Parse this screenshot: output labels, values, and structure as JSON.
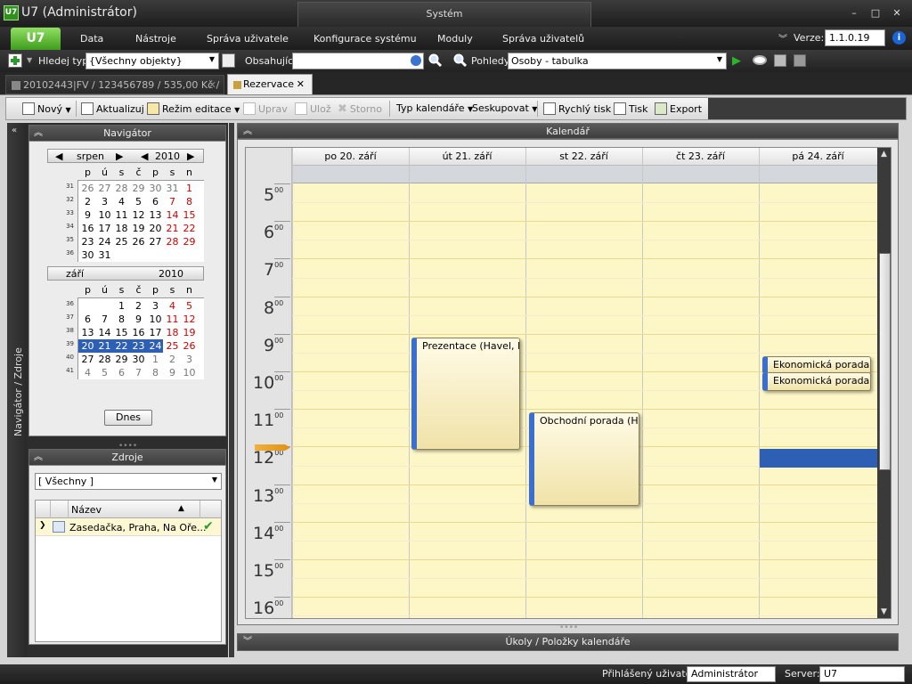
{
  "app": {
    "logo": "U7",
    "title": "U7 (Administrátor)",
    "system_tab": "Systém",
    "win_minimize": "–",
    "win_maximize": "□",
    "win_close": "✕"
  },
  "menu": {
    "logo": "U7",
    "items": [
      "Data",
      "Nástroje",
      "Správa uživatele",
      "Konfigurace systému",
      "Moduly",
      "Správa uživatelů"
    ],
    "version_label": "Verze:",
    "version_value": "1.1.0.19"
  },
  "search": {
    "type_label": "Hledej typ",
    "type_value": "{Všechny objekty}",
    "contains_label": "Obsahující",
    "contains_value": "",
    "views_label": "Pohledy",
    "views_value": "Osoby - tabulka"
  },
  "doc_tabs": [
    {
      "label": "20102443|FV / 123456789 / 535,00 Kč /",
      "close": "✕"
    },
    {
      "label": "Rezervace",
      "close": "✕"
    }
  ],
  "toolbar": {
    "new": "Nový",
    "refresh": "Aktualizuj",
    "edit_mode": "Režim editace",
    "edit": "Uprav",
    "save": "Ulož",
    "cancel": "Storno",
    "cal_type": "Typ kalendáře",
    "group": "Seskupovat",
    "quick_print": "Rychlý tisk",
    "print": "Tisk",
    "export": "Export"
  },
  "side_strip": {
    "label": "Navigátor / Zdroje"
  },
  "navigator": {
    "title": "Navigátor",
    "dow": [
      "p",
      "ú",
      "s",
      "č",
      "p",
      "s",
      "n"
    ],
    "month1": {
      "name": "srpen",
      "year": "2010",
      "weeks": [
        "31",
        "32",
        "33",
        "34",
        "35",
        "36"
      ],
      "rows": [
        [
          "26",
          "27",
          "28",
          "29",
          "30",
          "31",
          "1"
        ],
        [
          "2",
          "3",
          "4",
          "5",
          "6",
          "7",
          "8"
        ],
        [
          "9",
          "10",
          "11",
          "12",
          "13",
          "14",
          "15"
        ],
        [
          "16",
          "17",
          "18",
          "19",
          "20",
          "21",
          "22"
        ],
        [
          "23",
          "24",
          "25",
          "26",
          "27",
          "28",
          "29"
        ],
        [
          "30",
          "31",
          "",
          "",
          "",
          "",
          ""
        ]
      ]
    },
    "month2": {
      "name": "září",
      "year": "2010",
      "weeks": [
        "36",
        "37",
        "38",
        "39",
        "40",
        "41"
      ],
      "rows": [
        [
          "",
          "",
          "1",
          "2",
          "3",
          "4",
          "5"
        ],
        [
          "6",
          "7",
          "8",
          "9",
          "10",
          "11",
          "12"
        ],
        [
          "13",
          "14",
          "15",
          "16",
          "17",
          "18",
          "19"
        ],
        [
          "20",
          "21",
          "22",
          "23",
          "24",
          "25",
          "26"
        ],
        [
          "27",
          "28",
          "29",
          "30",
          "1",
          "2",
          "3"
        ],
        [
          "4",
          "5",
          "6",
          "7",
          "8",
          "9",
          "10"
        ]
      ]
    },
    "today_button": "Dnes"
  },
  "zdroje": {
    "title": "Zdroje",
    "filter_value": "[ Všechny ]",
    "column_name": "Název",
    "rows": [
      {
        "name": "Zasedačka, Praha, Na Oře..."
      }
    ]
  },
  "calendar": {
    "title": "Kalendář",
    "days": [
      "po 20. září",
      "út 21. září",
      "st 22. září",
      "čt 23. září",
      "pá 24. září"
    ],
    "hours": [
      "5",
      "6",
      "7",
      "8",
      "9",
      "10",
      "11",
      "12",
      "13",
      "14",
      "15",
      "16"
    ],
    "minutes": "00",
    "events": [
      {
        "title": "Prezentace (Havel, R"
      },
      {
        "title": "Obchodní porada (Hu"
      },
      {
        "title": "Ekonomická porada ("
      },
      {
        "title": "Ekonomická porada"
      }
    ]
  },
  "tasks": {
    "title": "Úkoly / Položky kalendáře"
  },
  "status": {
    "user_label": "Přihlášený uživatel:",
    "user_value": "Administrátor",
    "server_label": "Server:",
    "server_value": "U7"
  }
}
